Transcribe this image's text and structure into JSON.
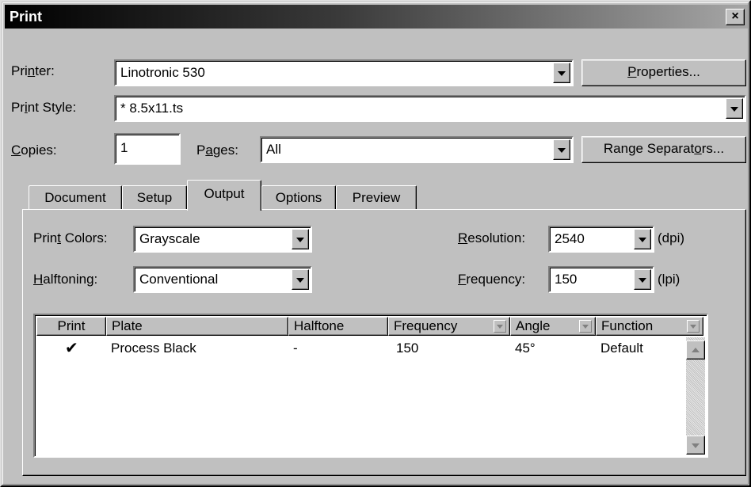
{
  "window": {
    "title": "Print",
    "close_glyph": "×"
  },
  "printer": {
    "label_pre": "Pri",
    "label_u": "n",
    "label_post": "ter:",
    "value": "Linotronic 530"
  },
  "properties_button": {
    "pre": "",
    "u": "P",
    "post": "roperties..."
  },
  "print_style": {
    "label_pre": "Pr",
    "label_u": "i",
    "label_post": "nt Style:",
    "value": "* 8.5x11.ts"
  },
  "copies": {
    "label_pre": "",
    "label_u": "C",
    "label_post": "opies:",
    "value": "1"
  },
  "pages": {
    "label_pre": "P",
    "label_u": "a",
    "label_post": "ges:",
    "value": "All"
  },
  "range_separators_button": {
    "pre": "Range Separat",
    "u": "o",
    "post": "rs..."
  },
  "tabs": [
    {
      "label": "Document",
      "active": false
    },
    {
      "label": "Setup",
      "active": false
    },
    {
      "label": "Output",
      "active": true
    },
    {
      "label": "Options",
      "active": false
    },
    {
      "label": "Preview",
      "active": false
    }
  ],
  "output": {
    "print_colors": {
      "label_pre": "Prin",
      "label_u": "t",
      "label_post": " Colors:",
      "value": "Grayscale"
    },
    "halftoning": {
      "label_pre": "",
      "label_u": "H",
      "label_post": "alftoning:",
      "value": "Conventional"
    },
    "resolution": {
      "label_pre": "",
      "label_u": "R",
      "label_post": "esolution:",
      "value": "2540",
      "unit": "(dpi)"
    },
    "frequency": {
      "label_pre": "",
      "label_u": "F",
      "label_post": "requency:",
      "value": "150",
      "unit": "(lpi)"
    }
  },
  "plates_table": {
    "columns": [
      "Print",
      "Plate",
      "Halftone",
      "Frequency",
      "Angle",
      "Function"
    ],
    "rows": [
      {
        "print": "✔",
        "plate": "Process Black",
        "halftone": "-",
        "frequency": "150",
        "angle": "45°",
        "function": "Default"
      }
    ]
  },
  "icons": [
    "close-icon",
    "dropdown-arrow-icon",
    "checkmark-icon",
    "scroll-up-icon",
    "scroll-down-icon"
  ]
}
